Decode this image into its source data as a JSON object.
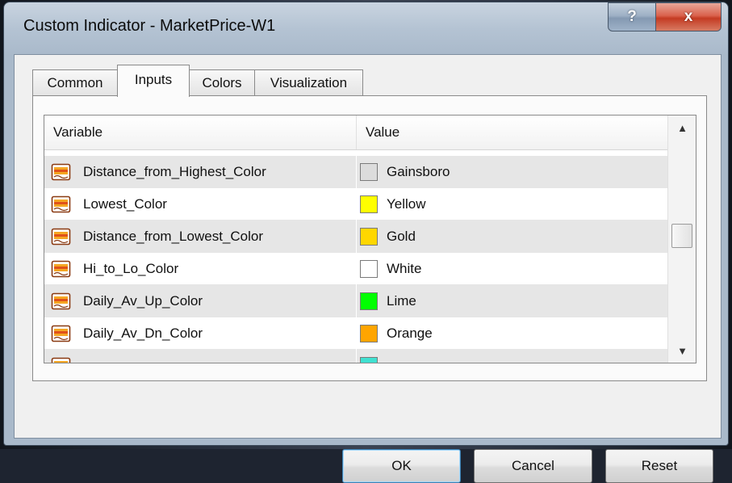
{
  "window": {
    "title": "Custom Indicator - MarketPrice-W1",
    "help_label": "?",
    "close_label": "x"
  },
  "tabs": [
    {
      "label": "Common",
      "active": false
    },
    {
      "label": "Inputs",
      "active": true
    },
    {
      "label": "Colors",
      "active": false
    },
    {
      "label": "Visualization",
      "active": false
    }
  ],
  "table": {
    "columns": [
      "Variable",
      "Value"
    ],
    "rows": [
      {
        "variable": "Distance_from_Highest_Color",
        "value": "Gainsboro",
        "color": "#dcdcdc"
      },
      {
        "variable": "Lowest_Color",
        "value": "Yellow",
        "color": "#ffff00"
      },
      {
        "variable": "Distance_from_Lowest_Color",
        "value": "Gold",
        "color": "#ffd700"
      },
      {
        "variable": "Hi_to_Lo_Color",
        "value": "White",
        "color": "#ffffff"
      },
      {
        "variable": "Daily_Av_Up_Color",
        "value": "Lime",
        "color": "#00ff00"
      },
      {
        "variable": "Daily_Av_Dn_Color",
        "value": "Orange",
        "color": "#ffa500"
      }
    ],
    "partial_row_color": "#40e0d0"
  },
  "scrollbar": {
    "up_icon": "scroll-up-arrow-icon",
    "down_icon": "scroll-down-arrow-icon"
  },
  "buttons": {
    "ok": "OK",
    "cancel": "Cancel",
    "reset": "Reset"
  },
  "accent": "#3c7fb1"
}
